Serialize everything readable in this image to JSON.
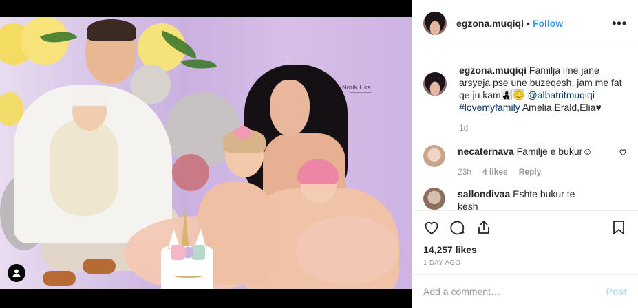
{
  "header": {
    "username": "egzona.muqiqi",
    "separator": "•",
    "follow_label": "Follow",
    "more_icon": "more-horizontal-icon",
    "more_glyph": "•••"
  },
  "photo": {
    "watermark": "Norik Uka"
  },
  "caption": {
    "username": "egzona.muqiqi",
    "text_part1": "Familja ime jane arsyeja pse une buzeqesh, jam me fat qe ju kam",
    "emoji": "👩‍👧‍👦😇",
    "mention": "@albatritmuqiqi",
    "hashtag": "#lovemyfamily",
    "text_part2": "Amelia,Erald,Elia",
    "heart": "♥",
    "time": "1d"
  },
  "comments": [
    {
      "username": "necaternava",
      "text": "Familje e bukur",
      "emoji": "☺",
      "time": "23h",
      "likes": "4 likes",
      "reply": "Reply"
    },
    {
      "username": "sallondivaa",
      "text": "Eshte bukur te kesh",
      "emoji": "",
      "time": "",
      "likes": "",
      "reply": ""
    }
  ],
  "actions": {
    "like_icon": "heart-icon",
    "comment_icon": "comment-icon",
    "share_icon": "share-icon",
    "save_icon": "bookmark-icon"
  },
  "stats": {
    "likes": "14,257 likes",
    "date": "1 DAY AGO"
  },
  "add_comment": {
    "placeholder": "Add a comment…",
    "post_label": "Post"
  },
  "colors": {
    "link_blue": "#3897f0",
    "mention_blue": "#003569",
    "post_disabled": "#b2dffc",
    "muted": "#999999"
  }
}
